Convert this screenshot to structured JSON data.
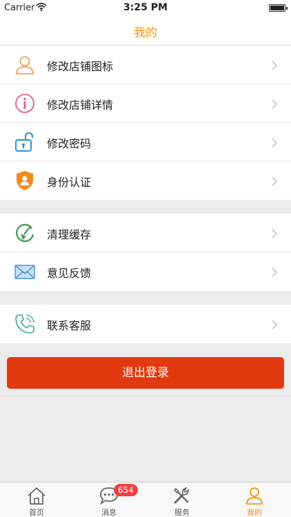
{
  "status_bar": {
    "carrier": "Carrier",
    "time": "3:25 PM"
  },
  "nav": {
    "title": "我的"
  },
  "groups": [
    {
      "items": [
        {
          "label": "修改店铺图标",
          "icon": "user-icon"
        },
        {
          "label": "修改店铺详情",
          "icon": "info-icon"
        },
        {
          "label": "修改密码",
          "icon": "unlock-icon"
        },
        {
          "label": "身份认证",
          "icon": "shield-user-icon"
        }
      ]
    },
    {
      "items": [
        {
          "label": "清理缓存",
          "icon": "broom-refresh-icon"
        },
        {
          "label": "意见反馈",
          "icon": "mail-icon"
        }
      ]
    },
    {
      "items": [
        {
          "label": "联系客服",
          "icon": "phone-icon"
        }
      ]
    }
  ],
  "logout": {
    "label": "退出登录"
  },
  "tabs": [
    {
      "label": "首页",
      "icon": "home-icon"
    },
    {
      "label": "消息",
      "icon": "chat-icon",
      "badge": "654"
    },
    {
      "label": "服务",
      "icon": "tools-icon"
    },
    {
      "label": "我的",
      "icon": "person-icon",
      "active": true
    }
  ],
  "colors": {
    "accent": "#f39200",
    "logout": "#e23a10",
    "badge": "#f04040"
  }
}
